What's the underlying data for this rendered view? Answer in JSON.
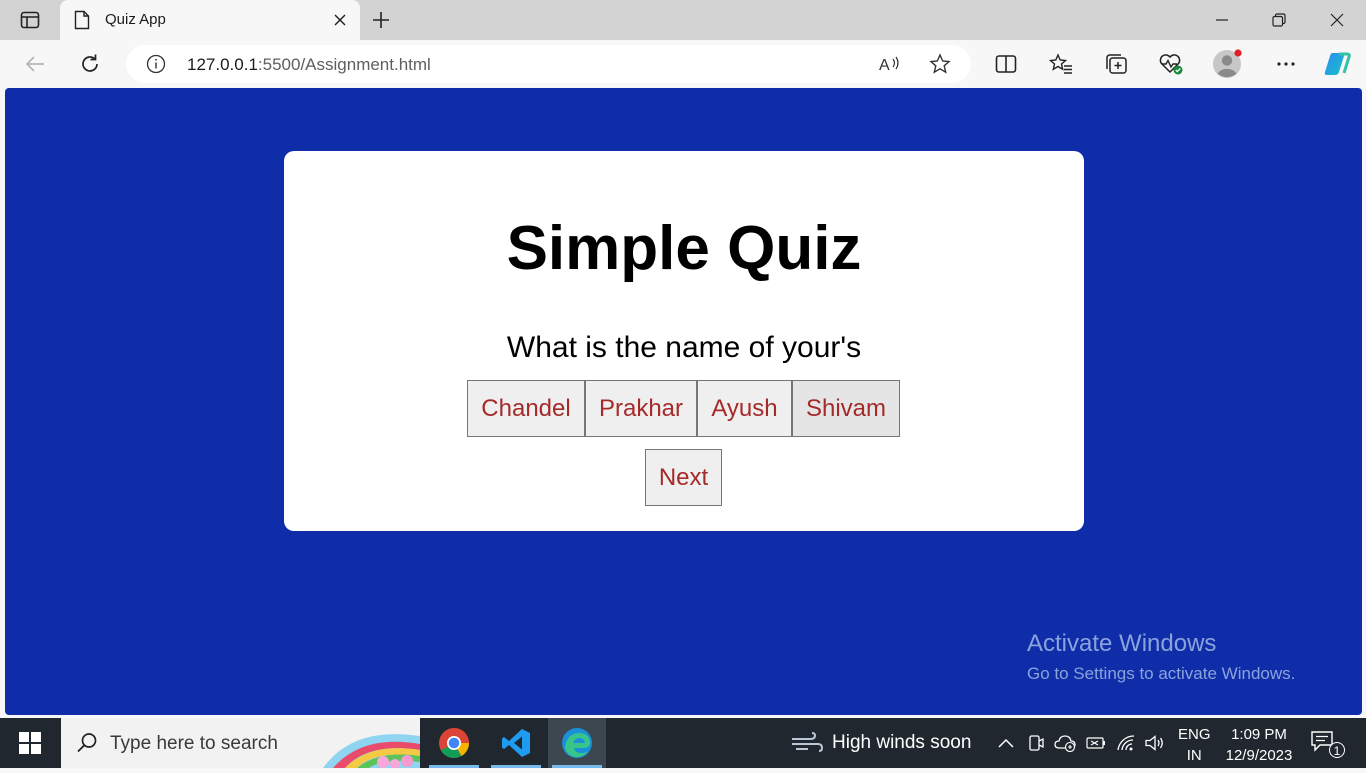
{
  "browser": {
    "tab_title": "Quiz App",
    "url_host": "127.0.0.1",
    "url_rest": ":5500/Assignment.html",
    "read_aloud_label": "Á"
  },
  "page": {
    "background_color": "#0f2da8",
    "title": "Simple Quiz",
    "question": "What is the name of your's",
    "options": [
      "Chandel",
      "Prakhar",
      "Ayush",
      "Shivam"
    ],
    "next_label": "Next",
    "button_text_color": "#a52a2a"
  },
  "watermark": {
    "line1": "Activate Windows",
    "line2": "Go to Settings to activate Windows."
  },
  "taskbar": {
    "search_placeholder": "Type here to search",
    "weather": "High winds soon",
    "lang_line1": "ENG",
    "lang_line2": "IN",
    "time": "1:09 PM",
    "date": "12/9/2023",
    "notification_count": "1",
    "apps": [
      "chrome-icon",
      "vscode-icon",
      "edge-icon"
    ]
  }
}
